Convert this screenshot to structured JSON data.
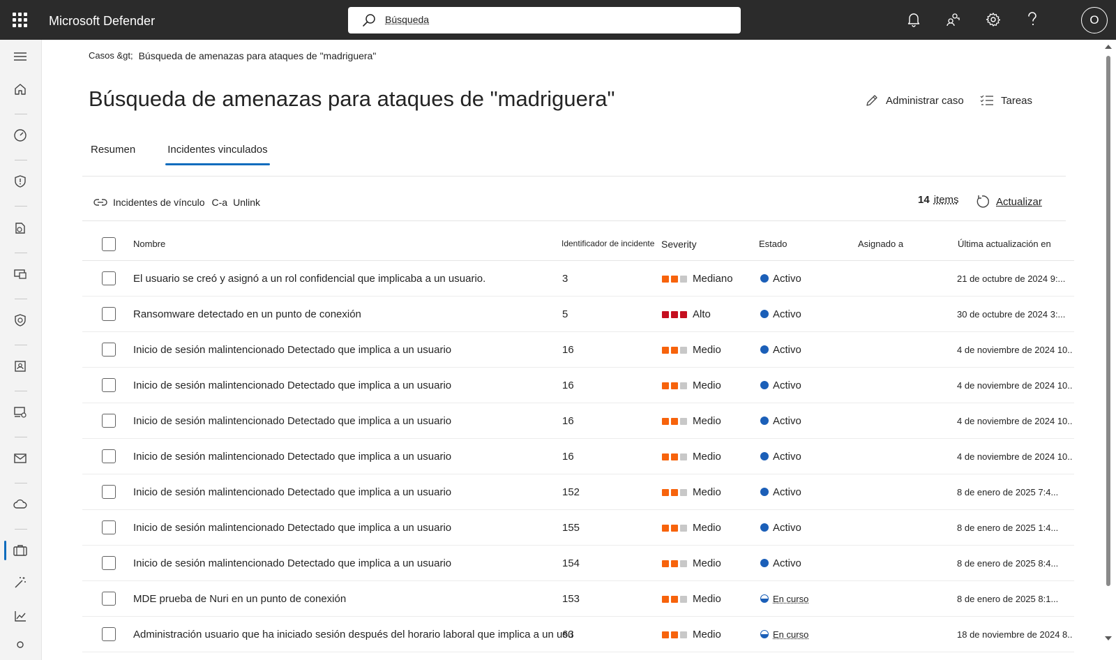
{
  "app": {
    "title": "Microsoft Defender",
    "user_initial": "O"
  },
  "search": {
    "placeholder": "Búsqueda"
  },
  "topbar_icons": [
    "bell-icon",
    "community-icon",
    "gear-icon",
    "help-icon"
  ],
  "rail_icons": [
    "hamburger-icon",
    "home-icon",
    "gauge-icon",
    "shield-icon",
    "assets-icon",
    "devices-icon",
    "shield-lock-icon",
    "id-card-icon",
    "endpoint-icon",
    "mail-icon",
    "cloud-icon",
    "briefcase-icon",
    "wand-icon",
    "chart-icon",
    "person-icon"
  ],
  "breadcrumb": {
    "root": "Casos &gt;",
    "current": "Búsqueda de amenazas para ataques de \"madriguera\""
  },
  "page": {
    "title": "Búsqueda de amenazas para ataques de \"madriguera\""
  },
  "commands": {
    "manage_case": "Administrar caso",
    "tasks": "Tareas"
  },
  "tabs": [
    {
      "label": "Resumen",
      "active": false
    },
    {
      "label": "Incidentes vinculados",
      "active": true
    }
  ],
  "toolbar": {
    "link_incidents": "Incidentes de vínculo",
    "shortcut": "C-a",
    "unlink": "Unlink",
    "count": "14",
    "items_label": "items",
    "refresh": "Actualizar"
  },
  "table": {
    "columns": {
      "name": "Nombre",
      "incident_id": "Identificador de incidente",
      "severity": "Severity",
      "status": "Estado",
      "assigned": "Asignado a",
      "updated": "Última actualización en"
    },
    "rows": [
      {
        "name": "El usuario se creó y asignó a un rol confidencial que implicaba a un usuario.",
        "id": "3",
        "severity": "Mediano",
        "sev_level": "medium",
        "status": "Activo",
        "status_type": "active",
        "assigned": "",
        "updated": "21 de octubre de 2024 9:..."
      },
      {
        "name": "Ransomware detectado en un punto de conexión",
        "id": "5",
        "severity": "Alto",
        "sev_level": "high",
        "status": "Activo",
        "status_type": "active",
        "assigned": "",
        "updated": "30 de octubre de 2024 3:..."
      },
      {
        "name": "Inicio de sesión malintencionado Detectado que implica a un usuario",
        "id": "16",
        "severity": "Medio",
        "sev_level": "medium",
        "status": "Activo",
        "status_type": "active",
        "assigned": "",
        "updated": "4 de noviembre de 2024 10..."
      },
      {
        "name": "Inicio de sesión malintencionado Detectado que implica a un usuario",
        "id": "16",
        "severity": "Medio",
        "sev_level": "medium",
        "status": "Activo",
        "status_type": "active",
        "assigned": "",
        "updated": "4 de noviembre de 2024 10..."
      },
      {
        "name": "Inicio de sesión malintencionado Detectado que implica a un usuario",
        "id": "16",
        "severity": "Medio",
        "sev_level": "medium",
        "status": "Activo",
        "status_type": "active",
        "assigned": "",
        "updated": "4 de noviembre de 2024 10..."
      },
      {
        "name": "Inicio de sesión malintencionado Detectado que implica a un usuario",
        "id": "16",
        "severity": "Medio",
        "sev_level": "medium",
        "status": "Activo",
        "status_type": "active",
        "assigned": "",
        "updated": "4 de noviembre de 2024 10..."
      },
      {
        "name": "Inicio de sesión malintencionado Detectado que implica a un usuario",
        "id": "152",
        "severity": "Medio",
        "sev_level": "medium",
        "status": "Activo",
        "status_type": "active",
        "assigned": "",
        "updated": "8 de enero de 2025 7:4..."
      },
      {
        "name": "Inicio de sesión malintencionado Detectado que implica a un usuario",
        "id": "155",
        "severity": "Medio",
        "sev_level": "medium",
        "status": "Activo",
        "status_type": "active",
        "assigned": "",
        "updated": "8 de enero de 2025 1:4..."
      },
      {
        "name": "Inicio de sesión malintencionado Detectado que implica a un usuario",
        "id": "154",
        "severity": "Medio",
        "sev_level": "medium",
        "status": "Activo",
        "status_type": "active",
        "assigned": "",
        "updated": "8 de enero de 2025 8:4..."
      },
      {
        "name": "MDE prueba de Nuri en un punto de conexión",
        "id": "153",
        "severity": "Medio",
        "sev_level": "medium",
        "status": "En curso",
        "status_type": "in-progress",
        "assigned": "",
        "updated": "8 de enero de 2025 8:1..."
      },
      {
        "name": "Administración usuario que ha iniciado sesión después del horario laboral que implica a un usuario",
        "id": "63",
        "severity": "Medio",
        "sev_level": "medium",
        "status": "En curso",
        "status_type": "in-progress",
        "assigned": "",
        "updated": "18 de noviembre de 2024 8..."
      }
    ]
  },
  "colors": {
    "accent": "#0f6cbd",
    "sev_medium": "#f7630c",
    "sev_high": "#c50f1f",
    "sev_empty": "#c8c8c8",
    "status_blue": "#1b5fb8"
  }
}
